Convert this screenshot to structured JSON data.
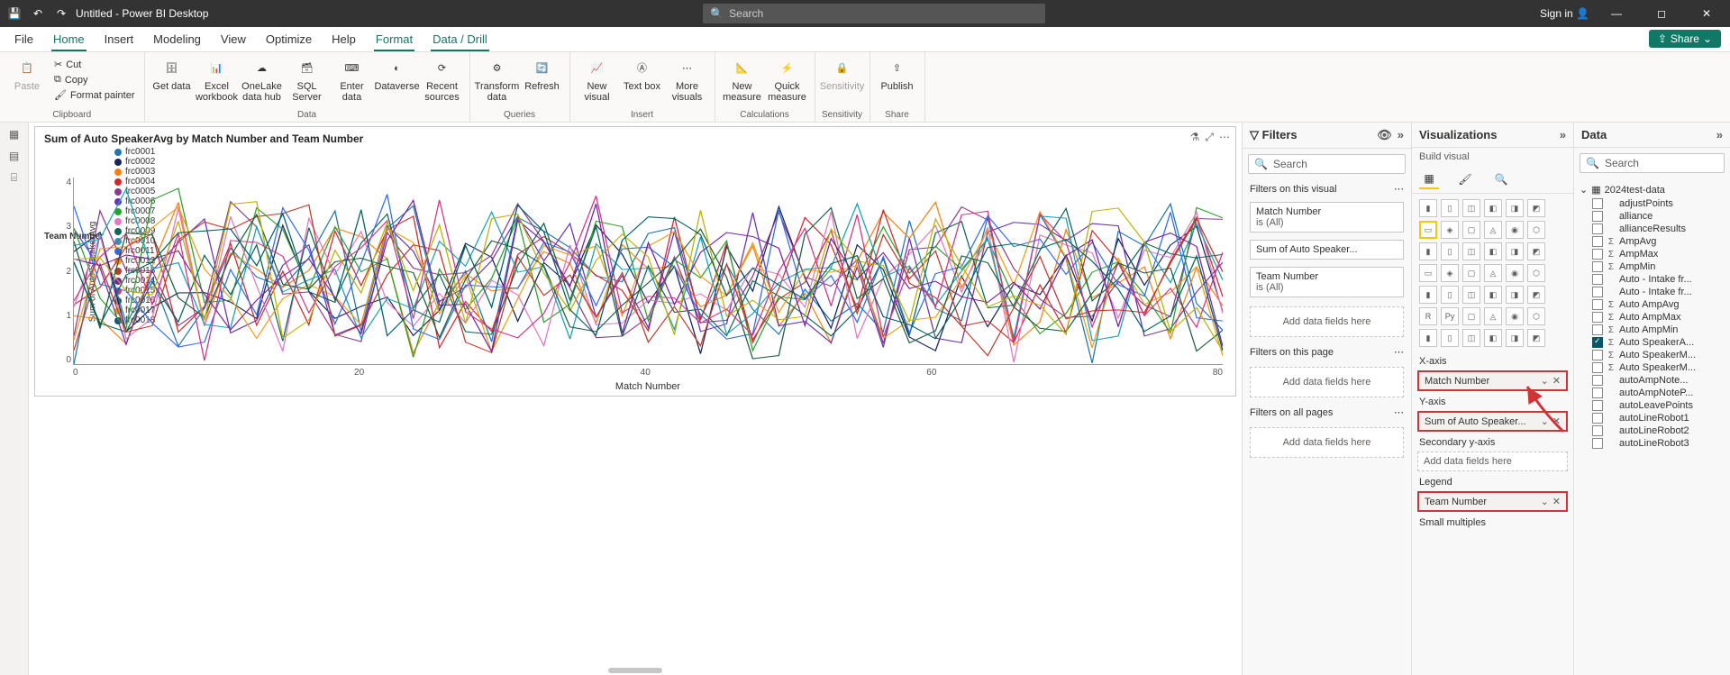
{
  "title_bar": {
    "doc_title": "Untitled - Power BI Desktop",
    "search_placeholder": "Search",
    "sign_in": "Sign in"
  },
  "menubar": {
    "items": [
      "File",
      "Home",
      "Insert",
      "Modeling",
      "View",
      "Optimize",
      "Help",
      "Format",
      "Data / Drill"
    ],
    "active_indices": [
      1,
      7,
      8
    ],
    "share_label": "Share"
  },
  "ribbon": {
    "clipboard": {
      "paste": "Paste",
      "cut": "Cut",
      "copy": "Copy",
      "format_painter": "Format painter",
      "group": "Clipboard"
    },
    "data": {
      "get_data": "Get data",
      "excel": "Excel workbook",
      "onelake": "OneLake data hub",
      "sql": "SQL Server",
      "enter": "Enter data",
      "dataverse": "Dataverse",
      "recent": "Recent sources",
      "group": "Data"
    },
    "queries": {
      "transform": "Transform data",
      "refresh": "Refresh",
      "group": "Queries"
    },
    "insert": {
      "new_visual": "New visual",
      "text_box": "Text box",
      "more_visuals": "More visuals",
      "group": "Insert"
    },
    "calculations": {
      "new_measure": "New measure",
      "quick_measure": "Quick measure",
      "group": "Calculations"
    },
    "sensitivity": {
      "sensitivity": "Sensitivity",
      "group": "Sensitivity"
    },
    "share": {
      "publish": "Publish",
      "group": "Share"
    }
  },
  "chart_data": {
    "type": "line",
    "title": "Sum of Auto SpeakerAvg by Match Number and Team Number",
    "xlabel": "Match Number",
    "ylabel": "Sum of Auto SpeakerAvg",
    "x_ticks": [
      0,
      20,
      40,
      60,
      80
    ],
    "y_ticks": [
      0,
      1,
      2,
      3,
      4
    ],
    "xlim": [
      0,
      90
    ],
    "ylim": [
      0,
      4.2
    ],
    "legend_title": "Team Number",
    "series": [
      {
        "name": "frc0001",
        "color": "#1f77b4"
      },
      {
        "name": "frc0002",
        "color": "#17245b"
      },
      {
        "name": "frc0003",
        "color": "#ff7f0e"
      },
      {
        "name": "frc0004",
        "color": "#d62728"
      },
      {
        "name": "frc0005",
        "color": "#8c3b8c"
      },
      {
        "name": "frc0006",
        "color": "#6a33b5"
      },
      {
        "name": "frc0007",
        "color": "#2ca02c"
      },
      {
        "name": "frc0008",
        "color": "#e377c2"
      },
      {
        "name": "frc0009",
        "color": "#0e6655"
      },
      {
        "name": "frc0010",
        "color": "#17a2b8"
      },
      {
        "name": "frc0011",
        "color": "#2f6df6"
      },
      {
        "name": "frc0012",
        "color": "#f39c12"
      },
      {
        "name": "frc0013",
        "color": "#c0392b"
      },
      {
        "name": "frc0014",
        "color": "#7b1fa2"
      },
      {
        "name": "frc0015",
        "color": "#d63384"
      },
      {
        "name": "frc0016",
        "color": "#1f5f3f"
      },
      {
        "name": "frc0017",
        "color": "#bdb200"
      },
      {
        "name": "frc0018",
        "color": "#006064"
      }
    ]
  },
  "filters": {
    "header": "Filters",
    "search_placeholder": "Search",
    "on_visual": {
      "label": "Filters on this visual",
      "cards": [
        {
          "name": "Match Number",
          "cond": "is (All)"
        },
        {
          "name": "Sum of Auto Speaker...",
          "cond": ""
        },
        {
          "name": "Team Number",
          "cond": "is (All)"
        }
      ]
    },
    "add_fields": "Add data fields here",
    "on_page": {
      "label": "Filters on this page"
    },
    "on_all": {
      "label": "Filters on all pages"
    }
  },
  "viz": {
    "header": "Visualizations",
    "sub": "Build visual",
    "axis_labels": {
      "x": "X-axis",
      "y": "Y-axis",
      "y2": "Secondary y-axis",
      "legend": "Legend",
      "small": "Small multiples"
    },
    "fields": {
      "x": "Match Number",
      "y": "Sum of Auto Speaker...",
      "legend": "Team Number"
    },
    "add_fields": "Add data fields here"
  },
  "data": {
    "header": "Data",
    "search_placeholder": "Search",
    "table": "2024test-data",
    "fields": [
      {
        "name": "adjustPoints",
        "sigma": false,
        "checked": false
      },
      {
        "name": "alliance",
        "sigma": false,
        "checked": false
      },
      {
        "name": "allianceResults",
        "sigma": false,
        "checked": false
      },
      {
        "name": "AmpAvg",
        "sigma": true,
        "checked": false
      },
      {
        "name": "AmpMax",
        "sigma": true,
        "checked": false
      },
      {
        "name": "AmpMin",
        "sigma": true,
        "checked": false
      },
      {
        "name": "Auto - Intake fr...",
        "sigma": false,
        "checked": false
      },
      {
        "name": "Auto - Intake fr...",
        "sigma": false,
        "checked": false
      },
      {
        "name": "Auto AmpAvg",
        "sigma": true,
        "checked": false
      },
      {
        "name": "Auto AmpMax",
        "sigma": true,
        "checked": false
      },
      {
        "name": "Auto AmpMin",
        "sigma": true,
        "checked": false
      },
      {
        "name": "Auto SpeakerA...",
        "sigma": true,
        "checked": true
      },
      {
        "name": "Auto SpeakerM...",
        "sigma": true,
        "checked": false
      },
      {
        "name": "Auto SpeakerM...",
        "sigma": true,
        "checked": false
      },
      {
        "name": "autoAmpNote...",
        "sigma": false,
        "checked": false
      },
      {
        "name": "autoAmpNoteP...",
        "sigma": false,
        "checked": false
      },
      {
        "name": "autoLeavePoints",
        "sigma": false,
        "checked": false
      },
      {
        "name": "autoLineRobot1",
        "sigma": false,
        "checked": false
      },
      {
        "name": "autoLineRobot2",
        "sigma": false,
        "checked": false
      },
      {
        "name": "autoLineRobot3",
        "sigma": false,
        "checked": false
      }
    ]
  }
}
